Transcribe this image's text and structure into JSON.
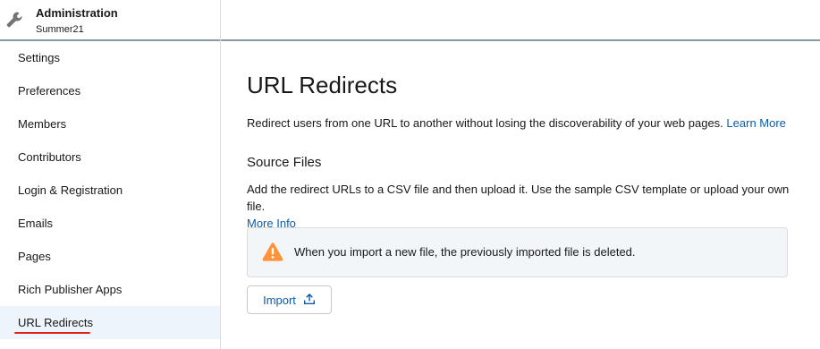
{
  "sidebar": {
    "header": {
      "icon": "wrench-icon",
      "title": "Administration",
      "subtitle": "Summer21"
    },
    "items": [
      {
        "label": "Settings"
      },
      {
        "label": "Preferences"
      },
      {
        "label": "Members"
      },
      {
        "label": "Contributors"
      },
      {
        "label": "Login & Registration"
      },
      {
        "label": "Emails"
      },
      {
        "label": "Pages"
      },
      {
        "label": "Rich Publisher Apps"
      },
      {
        "label": "URL Redirects",
        "active": true
      }
    ]
  },
  "main": {
    "title": "URL Redirects",
    "description": "Redirect users from one URL to another without losing the discoverability of your web pages.",
    "learn_more_link": "Learn More",
    "source_files": {
      "title": "Source Files",
      "description": "Add the redirect URLs to a CSV file and then upload it. Use the sample CSV template or upload your own file.",
      "more_info_link": "More Info"
    },
    "alert": {
      "icon": "warning-icon",
      "text": "When you import a new file, the previously imported file is deleted."
    },
    "import_button": {
      "label": "Import",
      "icon": "upload-icon"
    }
  },
  "colors": {
    "link": "#0b5cab",
    "warning": "#fe9339",
    "active_bg": "#eef4fb",
    "active_underline": "#e0211b",
    "header_border": "#8a9aac"
  }
}
